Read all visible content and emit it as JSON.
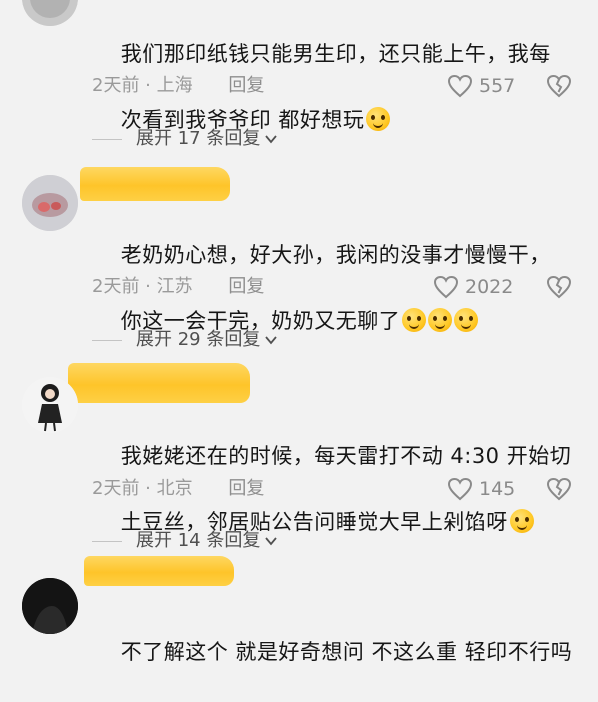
{
  "comments": [
    {
      "text_lines": [
        "我们那印纸钱只能男生印，还只能上午，我每",
        "次看到我爷爷印 都好想玩"
      ],
      "time_location": "2天前 · 上海",
      "reply_label": "回复",
      "likes": "557",
      "expand_label": "展开 17 条回复"
    },
    {
      "text_lines": [
        "老奶奶心想，好大孙，我闲的没事才慢慢干，",
        "你这一会干完，奶奶又无聊了"
      ],
      "time_location": "2天前 · 江苏",
      "reply_label": "回复",
      "likes": "2022",
      "expand_label": "展开 29 条回复"
    },
    {
      "text_lines": [
        "我姥姥还在的时候，每天雷打不动 4:30 开始切",
        "土豆丝，邻居贴公告问睡觉大早上剁馅呀"
      ],
      "time_location": "2天前 · 北京",
      "reply_label": "回复",
      "likes": "145",
      "expand_label": "展开 14 条回复"
    },
    {
      "text_lines": [
        "不了解这个 就是好奇想问 不这么重 轻印不行吗"
      ]
    }
  ],
  "colors": {
    "background": "#f2f2f2",
    "redaction": "#ffc21f",
    "meta_text": "#9a9a9a"
  },
  "icons": [
    "heart-icon",
    "broken-heart-icon",
    "chevron-down-icon",
    "emoji-icon"
  ]
}
